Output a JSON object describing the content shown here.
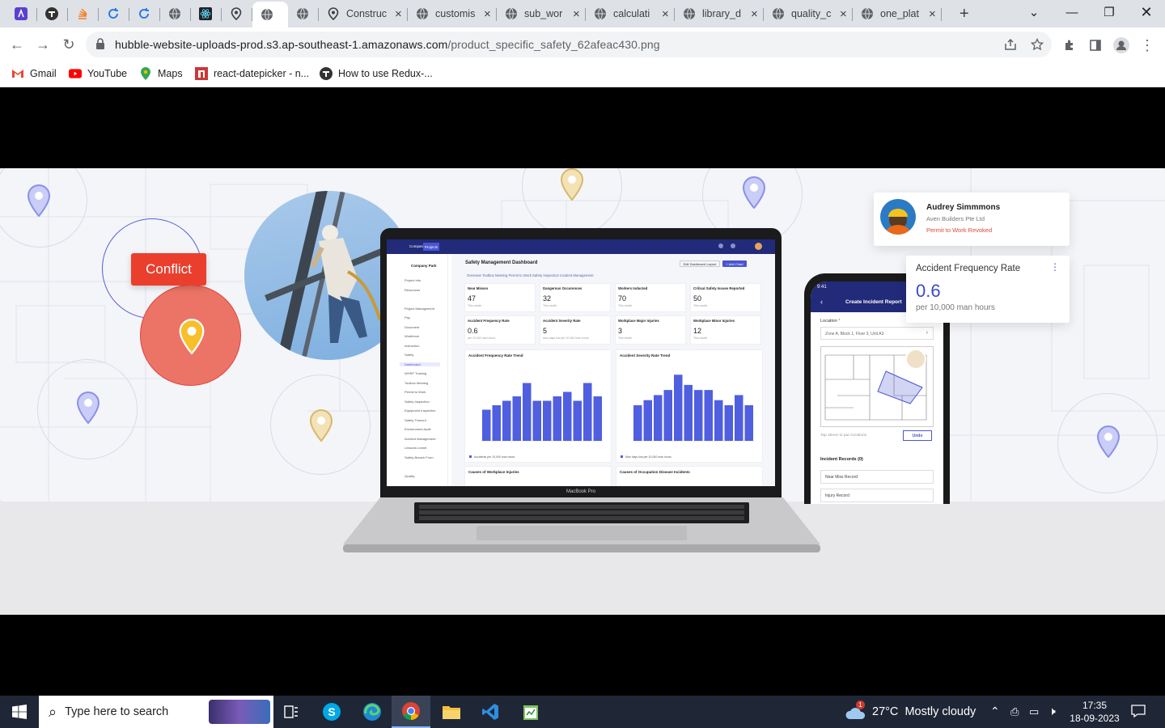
{
  "browser": {
    "tabs": [
      {
        "label": "",
        "icon": "purple-app-icon"
      },
      {
        "label": "",
        "icon": "t-logo-icon"
      },
      {
        "label": "",
        "icon": "stack-icon"
      },
      {
        "label": "",
        "icon": "sync-icon"
      },
      {
        "label": "",
        "icon": "sync-icon"
      },
      {
        "label": "",
        "icon": "globe-icon"
      },
      {
        "label": "",
        "icon": "react-icon"
      },
      {
        "label": "",
        "icon": "map-pin-icon"
      },
      {
        "label": "",
        "icon": "globe-icon",
        "active": true
      },
      {
        "label": "",
        "icon": "globe-icon"
      },
      {
        "label": "Construc",
        "icon": "map-pin-icon"
      },
      {
        "label": "customis",
        "icon": "globe-icon"
      },
      {
        "label": "sub_wor",
        "icon": "globe-icon"
      },
      {
        "label": "calculati",
        "icon": "globe-icon"
      },
      {
        "label": "library_d",
        "icon": "globe-icon"
      },
      {
        "label": "quality_c",
        "icon": "globe-icon"
      },
      {
        "label": "one_plat",
        "icon": "globe-icon"
      }
    ],
    "new_tab": "+",
    "url_host": "hubble-website-uploads-prod.s3.ap-southeast-1.amazonaws.com",
    "url_path": "/product_specific_safety_62afeac430.png",
    "bookmarks": [
      {
        "label": "Gmail",
        "icon": "gmail-icon"
      },
      {
        "label": "YouTube",
        "icon": "youtube-icon"
      },
      {
        "label": "Maps",
        "icon": "maps-icon"
      },
      {
        "label": "react-datepicker - n...",
        "icon": "npm-icon"
      },
      {
        "label": "How to use Redux-...",
        "icon": "t-logo-icon"
      }
    ]
  },
  "hero": {
    "conflict_label": "Conflict",
    "profile": {
      "name": "Audrey Simmmons",
      "company": "Aven Builders Pte Ltd",
      "status": "Permit to Work Revoked"
    },
    "afr_card": {
      "title": "Accident Frequency Rate",
      "value": "0.6",
      "unit": "per 10,000 man hours"
    }
  },
  "dashboard": {
    "nav": [
      "Company",
      "Projects"
    ],
    "company": "Company Park",
    "title": "Safety Management Dashboard",
    "tabs": "Overview   Toolbox Meeting   Permit to Work   Safety Inspection   Incident Management",
    "edit_btn": "Edit Dashboard Layout",
    "add_btn": "+ Add Chart",
    "sidebar": [
      "Project Info",
      "Resources",
      "",
      "Project Management",
      "Pay",
      "Document",
      "Workforce",
      "Instruction",
      "Safety",
      "Dashboard",
      "WHSP Training",
      "Toolbox Meeting",
      "Permit to Work",
      "Safety Inspection",
      "Equipment Inspection",
      "Safety Timeout",
      "Environment Audit",
      "Incident Management",
      "Lessons Learnt",
      "Safety Breach Form",
      "",
      "Quality"
    ],
    "kpis": [
      {
        "title": "Near Misses",
        "value": "47",
        "sub": "This month"
      },
      {
        "title": "Dangerous Occurences",
        "value": "32",
        "sub": "This month"
      },
      {
        "title": "Workers Inducted",
        "value": "70",
        "sub": "This month"
      },
      {
        "title": "Critical Safety Issues Reported",
        "value": "50",
        "sub": "This month"
      },
      {
        "title": "Accident Frequency Rate",
        "value": "0.6",
        "sub": "per 10,000 man hours"
      },
      {
        "title": "Accident Severity Rate",
        "value": "5",
        "sub": "man days lost per 10,000 man hours"
      },
      {
        "title": "Workplace Major Injuries",
        "value": "3",
        "sub": "This month"
      },
      {
        "title": "Workplace Minor Injuries",
        "value": "12",
        "sub": "This month"
      }
    ],
    "bottom_cards": [
      "Causes of Workplace Injuries",
      "Causes of Occupation Disease Incidents"
    ],
    "laptop_label": "MacBook Pro"
  },
  "chart_data": [
    {
      "type": "bar",
      "title": "Accident Frequency Rate Trend",
      "values": [
        0.35,
        0.4,
        0.45,
        0.5,
        0.65,
        0.45,
        0.45,
        0.5,
        0.55,
        0.45,
        0.65,
        0.5
      ],
      "ylim": [
        0,
        0.8
      ],
      "legend": "Accidents per 10,000 man hours",
      "color": "#4f5fe0"
    },
    {
      "type": "bar",
      "title": "Accident Severity Rate Trend",
      "values": [
        3.5,
        4.0,
        4.5,
        5.0,
        6.5,
        5.5,
        5.0,
        5.0,
        4.0,
        3.5,
        4.5,
        3.5
      ],
      "ylim": [
        0,
        7
      ],
      "legend": "Man days lost per 10,000 man hours",
      "color": "#4f5fe0"
    }
  ],
  "phone": {
    "time": "9:41",
    "title": "Create Incident Report",
    "location_label": "Location",
    "location_value": "Zone A, Block 1, Floor 3, Unit A3",
    "tap_hint": "Tap above to pan locations",
    "undo": "Undo",
    "records_label": "Incident Records (0)",
    "records": [
      "Near Miss Record",
      "Injury Record"
    ]
  },
  "taskbar": {
    "search_placeholder": "Type here to search",
    "weather": "27°C  Mostly cloudy",
    "weather_badge": "1",
    "time": "17:35",
    "date": "18-09-2023"
  }
}
